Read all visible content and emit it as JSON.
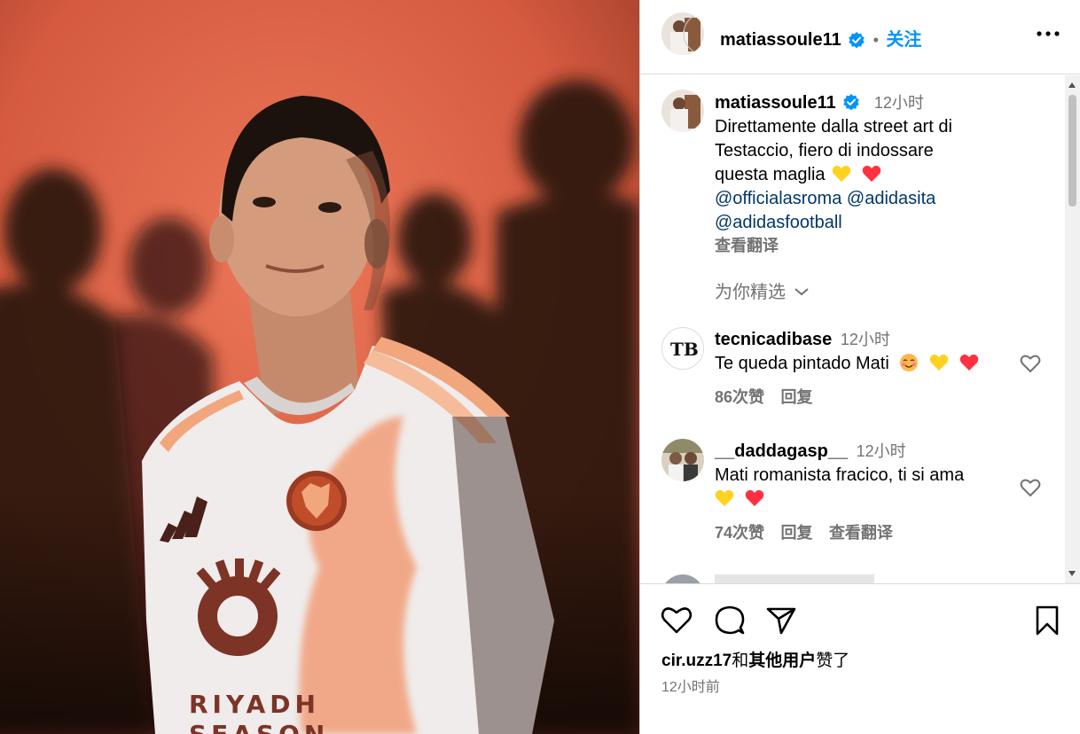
{
  "post": {
    "username": "matiassoule11",
    "follow_label": "关注",
    "separator": "•",
    "caption": {
      "time": "12小时",
      "text_line1": "Direttamente dalla street art di",
      "text_line2": "Testaccio, fiero di indossare",
      "text_line3": "questa maglia",
      "mention1": "@officialasroma",
      "mention2": "@adidasita",
      "mention3": "@adidasfootball",
      "translate": "查看翻译"
    },
    "curated_label": "为你精选",
    "jersey_sponsor_line1": "RIYADH",
    "jersey_sponsor_line2": "SEASON"
  },
  "comments": [
    {
      "username": "tecnicadibase",
      "time": "12小时",
      "text": "Te queda pintado Mati",
      "likes": "86次赞",
      "reply": "回复",
      "avatar_text": "TB"
    },
    {
      "username": "__daddagasp__",
      "time": "12小时",
      "text": "Mati romanista fracico, ti si ama",
      "likes": "74次赞",
      "reply": "回复",
      "translate": "查看翻译"
    },
    {
      "username": "",
      "time": ""
    }
  ],
  "footer": {
    "liked_user": "cir.uzz17",
    "liked_and": "和",
    "liked_others": "其他用户",
    "liked_suffix": "赞了",
    "time_ago": "12小时前"
  },
  "colors": {
    "accent": "#0095f6",
    "mention": "#00376b",
    "muted": "#737373",
    "heart_red": "#ff3040",
    "heart_yellow": "#ffd21f",
    "photo_bg": "#e4664a"
  },
  "icons": [
    "verified-icon",
    "more-icon",
    "chevron-down-icon",
    "heart-icon",
    "comment-icon",
    "share-icon",
    "bookmark-icon"
  ]
}
